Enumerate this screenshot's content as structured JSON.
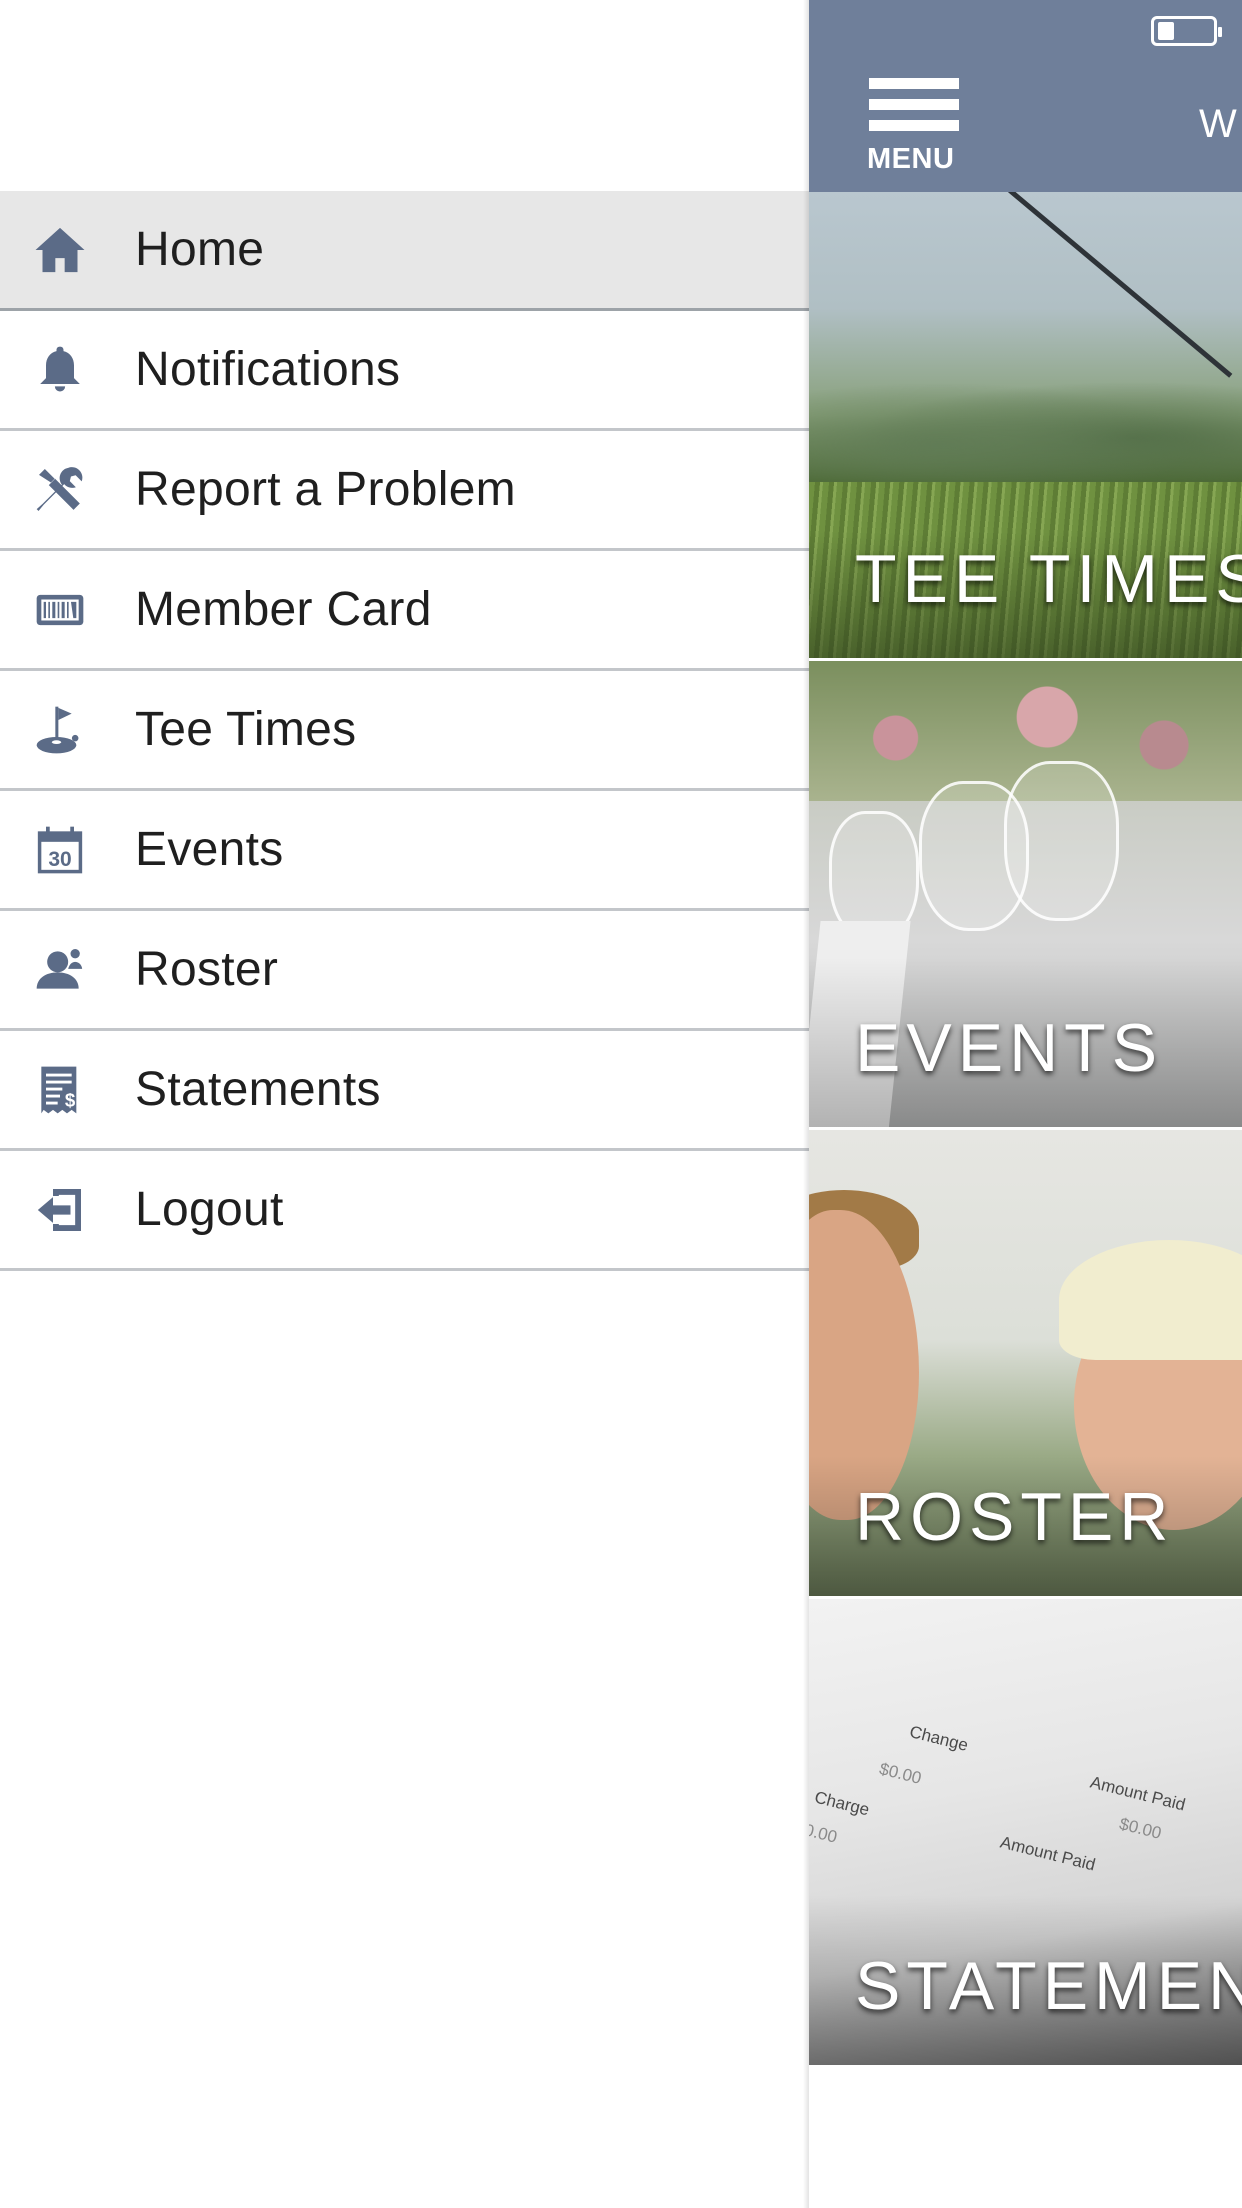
{
  "colors": {
    "header_bg": "#6f7f9a",
    "icon": "#5b6b87",
    "active_row_bg": "#e7e7e7",
    "divider": "#c3c6ca"
  },
  "drawer": {
    "items": [
      {
        "label": "Home",
        "icon": "home-icon",
        "active": true
      },
      {
        "label": "Notifications",
        "icon": "bell-icon"
      },
      {
        "label": "Report a Problem",
        "icon": "tools-icon"
      },
      {
        "label": "Member Card",
        "icon": "barcode-card-icon"
      },
      {
        "label": "Tee Times",
        "icon": "golf-flag-icon"
      },
      {
        "label": "Events",
        "icon": "calendar-icon"
      },
      {
        "label": "Roster",
        "icon": "person-icon"
      },
      {
        "label": "Statements",
        "icon": "statement-icon"
      },
      {
        "label": "Logout",
        "icon": "logout-icon"
      }
    ]
  },
  "header": {
    "menu_label": "MENU",
    "welcome_text": "W"
  },
  "tiles": [
    {
      "label": "TEE TIMES"
    },
    {
      "label": "EVENTS"
    },
    {
      "label": "ROSTER"
    },
    {
      "label": "STATEMENTS"
    }
  ],
  "statement_image_text": [
    "Change",
    "$0.00",
    "Amount Paid",
    "Charge",
    "0.00",
    "$0.00",
    "Amount Paid"
  ]
}
